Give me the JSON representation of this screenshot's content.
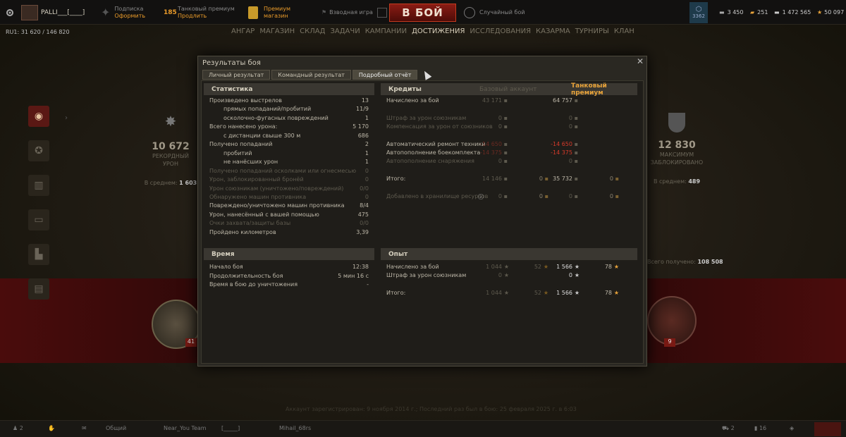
{
  "topbar": {
    "player": "PALLI___[____]",
    "subscription_label": "Подписка",
    "subscription_action": "Оформить",
    "days": "185",
    "tank_premium_label": "Танковый премиум",
    "tank_premium_action": "Продлить",
    "premium_shop_label1": "Премиум",
    "premium_shop_label2": "магазин",
    "platoon": "Взводная игра",
    "battle_button": "В БОЙ",
    "battle_mode": "Случайный бой",
    "clan_count": "3362",
    "currencies": {
      "bonds": "3 450",
      "gold": "251",
      "credits": "1 472 565",
      "free_xp": "50 097"
    }
  },
  "nav": [
    "АНГАР",
    "МАГАЗИН",
    "СКЛАД",
    "ЗАДАЧИ",
    "КАМПАНИИ",
    "ДОСТИЖЕНИЯ",
    "ИССЛЕДОВАНИЯ",
    "КАЗАРМА",
    "ТУРНИРЫ",
    "КЛАН"
  ],
  "account_id": "RU1: 31 620 / 146 820",
  "profile": {
    "left_stat": {
      "value": "10 672",
      "label1": "РЕКОРДНЫЙ",
      "label2": "УРОН",
      "avg_label": "В среднем:",
      "avg_value": "1 603"
    },
    "right_stat": {
      "value": "12 830",
      "label1": "МАКСИМУМ",
      "label2": "ЗАБЛОКИРОВАНО",
      "avg_label": "В среднем:",
      "avg_value": "489"
    },
    "total_label": "Всего получено:",
    "total_value": "108 508",
    "badge_left_num": "41",
    "badge_right_num": "9",
    "registered": "Аккаунт зарегистрирован: 9 ноября 2014 г.; Последний раз был в бою: 25 февраля 2025 г. в 6:03"
  },
  "bottombar": {
    "friends": "2",
    "channel1": "Общий",
    "channel2": "Near_You Team",
    "channel3": "[_____]",
    "channel4": "Mihail_68rs",
    "right1": "2",
    "right2": "16"
  },
  "dialog": {
    "title": "Результаты боя",
    "tabs": [
      "Личный результат",
      "Командный результат",
      "Подробный отчёт"
    ],
    "stats": {
      "header": "Статистика",
      "rows": [
        {
          "label": "Произведено выстрелов",
          "value": "13",
          "indent": false,
          "dim": false
        },
        {
          "label": "прямых попаданий/пробитий",
          "value": "11/9",
          "indent": true,
          "dim": false
        },
        {
          "label": "осколочно-фугасных повреждений",
          "value": "1",
          "indent": true,
          "dim": false
        },
        {
          "label": "Всего нанесено урона:",
          "value": "5 170",
          "indent": false,
          "dim": false
        },
        {
          "label": "с дистанции свыше 300 м",
          "value": "686",
          "indent": true,
          "dim": false
        },
        {
          "label": "Получено попаданий",
          "value": "2",
          "indent": false,
          "dim": false
        },
        {
          "label": "пробитий",
          "value": "1",
          "indent": true,
          "dim": false
        },
        {
          "label": "не нанёсших урон",
          "value": "1",
          "indent": true,
          "dim": false
        },
        {
          "label": "Получено попаданий осколками или огнесмесью",
          "value": "0",
          "indent": false,
          "dim": true
        },
        {
          "label": "Урон, заблокированный бронёй",
          "value": "0",
          "indent": false,
          "dim": true
        },
        {
          "label": "Урон союзникам (уничтожено/повреждений)",
          "value": "0/0",
          "indent": false,
          "dim": true
        },
        {
          "label": "Обнаружено машин противника",
          "value": "0",
          "indent": false,
          "dim": true
        },
        {
          "label": "Повреждено/уничтожено машин противника",
          "value": "8/4",
          "indent": false,
          "dim": false
        },
        {
          "label": "Урон, нанесённый с вашей помощью",
          "value": "475",
          "indent": false,
          "dim": false
        },
        {
          "label": "Очки захвата/защиты базы",
          "value": "0/0",
          "indent": false,
          "dim": true
        },
        {
          "label": "Пройдено километров",
          "value": "3,39",
          "indent": false,
          "dim": false
        }
      ]
    },
    "time": {
      "header": "Время",
      "rows": [
        {
          "label": "Начало боя",
          "value": "12:38"
        },
        {
          "label": "Продолжительность боя",
          "value": "5 мин 16 с"
        },
        {
          "label": "Время в бою до уничтожения",
          "value": "-"
        }
      ]
    },
    "credits": {
      "header": "Кредиты",
      "col_base": "Базовый аккаунт",
      "col_prem": "Танковый премиум",
      "rows": [
        {
          "label": "Начислено за бой",
          "base": "43 171",
          "base_b": "",
          "prem": "64 757",
          "prem_b": "",
          "type": "normal"
        },
        {
          "label": "Штраф за урон союзникам",
          "base": "0",
          "base_b": "",
          "prem": "0",
          "prem_b": "",
          "type": "dim"
        },
        {
          "label": "Компенсация за урон от союзников",
          "base": "0",
          "base_b": "",
          "prem": "0",
          "prem_b": "",
          "type": "dim"
        },
        {
          "label": "Автоматический ремонт техники",
          "base": "-14 650",
          "base_b": "",
          "prem": "-14 650",
          "prem_b": "",
          "type": "red"
        },
        {
          "label": "Автопополнение боекомплекта",
          "base": "-14 375",
          "base_b": "",
          "prem": "-14 375",
          "prem_b": "",
          "type": "red"
        },
        {
          "label": "Автопополнение снаряжения",
          "base": "0",
          "base_b": "",
          "prem": "0",
          "prem_b": "",
          "type": "dim"
        },
        {
          "label": "Итого:",
          "base": "14 146",
          "base_b": "0",
          "prem": "35 732",
          "prem_b": "0",
          "type": "total"
        },
        {
          "label": "Добавлено в хранилище ресурсов",
          "base": "0",
          "base_b": "0",
          "prem": "0",
          "prem_b": "0",
          "type": "dim"
        }
      ]
    },
    "xp": {
      "header": "Опыт",
      "rows": [
        {
          "label": "Начислено за бой",
          "base": "1 044",
          "base_f": "52",
          "prem": "1 566",
          "prem_f": "78"
        },
        {
          "label": "Штраф за урон союзникам",
          "base": "0",
          "base_f": "",
          "prem": "0",
          "prem_f": ""
        },
        {
          "label": "Итого:",
          "base": "1 044",
          "base_f": "52",
          "prem": "1 566",
          "prem_f": "78"
        }
      ]
    }
  }
}
